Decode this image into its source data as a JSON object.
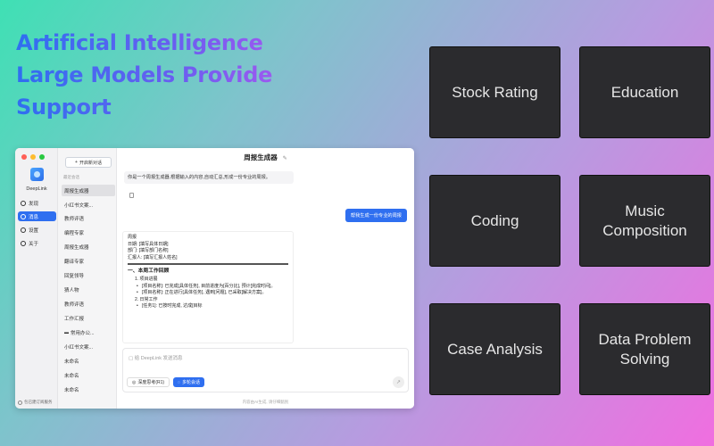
{
  "headline": [
    "Artificial Intelligence",
    "Large Models Provide",
    "Support"
  ],
  "tiles": [
    "Stock Rating",
    "Education",
    "Coding",
    "Music Composition",
    "Case Analysis",
    "Data Problem Solving"
  ],
  "app": {
    "brand": "DeepLink",
    "nav": [
      "发现",
      "消息",
      "设置",
      "关于"
    ],
    "subscription_note": "包已建订阅服务",
    "new_chat": "开启新对话",
    "recent_label": "最近会话",
    "conversations": [
      "周报生成器",
      "小红书文案...",
      "教师评语",
      "编程专家",
      "周报生成器",
      "翻译专家",
      "回复领导",
      "猜人物",
      "教师评语",
      "工作汇报",
      "常用办公...",
      "小红书文案...",
      "未命名",
      "未命名",
      "未命名"
    ],
    "title": "周报生成器",
    "system_message": "你是一个周报生成器,根据输入的内容,自动汇总,形成一份专业的周报。",
    "user_message": "帮我生成一份专业的周报",
    "doc": {
      "heading": "周报",
      "date": "日期: [填写具体日期]",
      "dept": "部门: [填写部门名称]",
      "reporter": "汇报人: [填写汇报人姓名]",
      "section1": "一、本周工作回顾",
      "item1": "1. 项目进展",
      "b1": "[项目名称]: 已完成[具体任务], 目前进度为[百分比], 预计[完成时间]。",
      "b2": "[项目名称]: 正在进行[具体任务], 遇到[问题], 已采取[解决方案]。",
      "item2": "2. 日常工作",
      "b3": "[任务1]: 已按时完成, 达成[目标"
    },
    "input_placeholder": "给 DeepLink 发送消息",
    "chip_think": "深度思考(R1)",
    "chip_multi": "多轮会话",
    "footer": "内容由AI生成, 请仔细甄别"
  }
}
